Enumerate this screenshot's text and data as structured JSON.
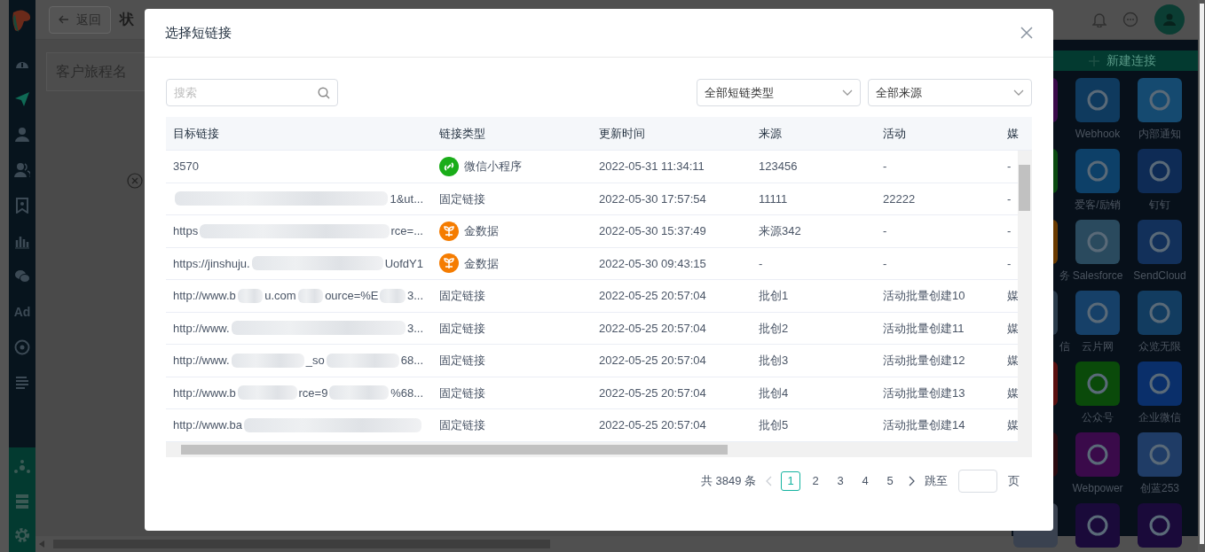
{
  "sidebar": {
    "items": [
      {
        "kind": "dashboard",
        "selected": false
      },
      {
        "kind": "send",
        "selected": true
      },
      {
        "kind": "user",
        "selected": false
      },
      {
        "kind": "users",
        "selected": false
      },
      {
        "kind": "bookmark",
        "selected": false
      },
      {
        "kind": "chart",
        "selected": false
      },
      {
        "kind": "wechat",
        "selected": false
      },
      {
        "kind": "text",
        "label": "Ad",
        "selected": false
      },
      {
        "kind": "target",
        "selected": false
      },
      {
        "kind": "list",
        "selected": false
      }
    ],
    "bottom_items": [
      {
        "kind": "network"
      },
      {
        "kind": "server"
      },
      {
        "kind": "settings"
      }
    ]
  },
  "topbar": {
    "back_button": "返回",
    "page_title": "状"
  },
  "journey_name": {
    "placeholder": "客户旅程名"
  },
  "connections": {
    "new_button": "新建连接",
    "tiles": [
      {
        "color": "#3a0a4a"
      },
      {
        "label": "Webhook",
        "color": "#0f3a5e"
      },
      {
        "label": "内部通知",
        "color": "#154a70"
      },
      {
        "color": "#0a4a10"
      },
      {
        "label": "爱客/励销",
        "color": "#0d4068"
      },
      {
        "label": "钉钉",
        "color": "#0e2b55"
      },
      {
        "label": "务",
        "color": "#6a3a00"
      },
      {
        "label": "Salesforce",
        "color": "#2a4a5e"
      },
      {
        "label": "SendCloud",
        "color": "#12305a"
      },
      {
        "label": "信",
        "color": "#2a3a4a"
      },
      {
        "label": "云片网",
        "color": "#164068"
      },
      {
        "label": "众览无限",
        "color": "#123c60"
      },
      {
        "color": "#5a1010"
      },
      {
        "label": "公众号",
        "color": "#0a4a0a"
      },
      {
        "label": "企业微信",
        "color": "#0a2f6a"
      },
      {
        "color": "#2a0a10"
      },
      {
        "label": "Webpower",
        "color": "#3a0a4a"
      },
      {
        "label": "创蓝253",
        "color": "#1f3c66"
      },
      {
        "color": "#3a4250"
      },
      {
        "color": "#1a0a3a"
      },
      {
        "color": "#1a0a3a"
      }
    ]
  },
  "dialog": {
    "title": "选择短链接",
    "search": {
      "placeholder": "搜索"
    },
    "filters": [
      "全部短链类型",
      "全部来源"
    ],
    "table": {
      "columns": [
        "目标链接",
        "链接类型",
        "更新时间",
        "来源",
        "活动",
        "媒"
      ],
      "rows": [
        {
          "target": [
            {
              "kind": "text",
              "text": "3570"
            }
          ],
          "type": {
            "kind": "miniprogram",
            "label": "微信小程序"
          },
          "updated": "2022-05-31 11:34:11",
          "source": "123456",
          "activity": "-",
          "column_6": "-"
        },
        {
          "target": [
            {
              "kind": "blur"
            },
            {
              "kind": "text",
              "text": "1&ut..."
            }
          ],
          "type": {
            "kind": "fixed",
            "label": "固定链接"
          },
          "updated": "2022-05-30 17:57:54",
          "source": "11111",
          "activity": "22222",
          "column_6": "-"
        },
        {
          "target": [
            {
              "kind": "text",
              "text": "https"
            },
            {
              "kind": "blur"
            },
            {
              "kind": "text",
              "text": "rce=..."
            }
          ],
          "type": {
            "kind": "jinshuju",
            "label": "金数据"
          },
          "updated": "2022-05-30 15:37:49",
          "source": "来源342",
          "activity": "-",
          "column_6": "-"
        },
        {
          "target": [
            {
              "kind": "text",
              "text": "https://jinshuju."
            },
            {
              "kind": "blur"
            },
            {
              "kind": "text",
              "text": "UofdY1"
            }
          ],
          "type": {
            "kind": "jinshuju",
            "label": "金数据"
          },
          "updated": "2022-05-30 09:43:15",
          "source": "-",
          "activity": "-",
          "column_6": "-"
        },
        {
          "target": [
            {
              "kind": "text",
              "text": "http://www.b"
            },
            {
              "kind": "blur"
            },
            {
              "kind": "text",
              "text": "u.com"
            },
            {
              "kind": "blur"
            },
            {
              "kind": "text",
              "text": "ource=%E"
            },
            {
              "kind": "blur"
            },
            {
              "kind": "text",
              "text": "3..."
            }
          ],
          "type": {
            "kind": "fixed",
            "label": "固定链接"
          },
          "updated": "2022-05-25 20:57:04",
          "source": "批创1",
          "activity": "活动批量创建10",
          "column_6": "媒"
        },
        {
          "target": [
            {
              "kind": "text",
              "text": "http://www."
            },
            {
              "kind": "blur"
            },
            {
              "kind": "text",
              "text": "3..."
            }
          ],
          "type": {
            "kind": "fixed",
            "label": "固定链接"
          },
          "updated": "2022-05-25 20:57:04",
          "source": "批创2",
          "activity": "活动批量创建11",
          "column_6": "媒"
        },
        {
          "target": [
            {
              "kind": "text",
              "text": "http://www."
            },
            {
              "kind": "blur"
            },
            {
              "kind": "text",
              "text": "_so"
            },
            {
              "kind": "blur"
            },
            {
              "kind": "text",
              "text": "68..."
            }
          ],
          "type": {
            "kind": "fixed",
            "label": "固定链接"
          },
          "updated": "2022-05-25 20:57:04",
          "source": "批创3",
          "activity": "活动批量创建12",
          "column_6": "媒"
        },
        {
          "target": [
            {
              "kind": "text",
              "text": "http://www.b"
            },
            {
              "kind": "blur"
            },
            {
              "kind": "text",
              "text": "rce=9"
            },
            {
              "kind": "blur"
            },
            {
              "kind": "text",
              "text": "%68..."
            }
          ],
          "type": {
            "kind": "fixed",
            "label": "固定链接"
          },
          "updated": "2022-05-25 20:57:04",
          "source": "批创4",
          "activity": "活动批量创建13",
          "column_6": "媒"
        },
        {
          "target": [
            {
              "kind": "text",
              "text": "http://www.ba"
            },
            {
              "kind": "blur"
            }
          ],
          "type": {
            "kind": "fixed",
            "label": "固定链接"
          },
          "updated": "2022-05-25 20:57:04",
          "source": "批创5",
          "activity": "活动批量创建14",
          "column_6": "媒"
        }
      ]
    },
    "pagination": {
      "total": "共 3849 条",
      "pages": [
        {
          "label": "1",
          "selected": true
        },
        {
          "label": "2",
          "selected": false
        },
        {
          "label": "3",
          "selected": false
        },
        {
          "label": "4",
          "selected": false
        },
        {
          "label": "5",
          "selected": false
        }
      ],
      "prev_disabled": true,
      "jump_label": "跳至",
      "page_unit": "页"
    }
  }
}
